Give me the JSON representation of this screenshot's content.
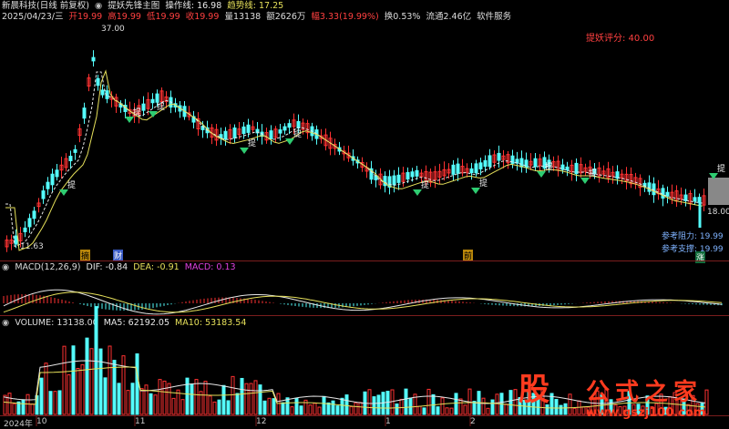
{
  "main": {
    "stock_name": "新晨科技(日线 前复权)",
    "indicator_name": "提妖先锋主图",
    "op_line": "操作线: 16.98",
    "trend_line": "趋势线: 17.25",
    "date": "2025/04/23/三",
    "open": "开19.99",
    "high": "高19.99",
    "low": "低19.99",
    "close": "收19.99",
    "volume": "量13138",
    "amount": "额2626万",
    "change": "幅3.33(19.99%)",
    "turnover": "换0.53%",
    "float": "流通2.46亿",
    "sector": "软件服务",
    "score": "提妖评分: 40.00",
    "max_price": "37.00",
    "min_price": "11.63",
    "resistance": "参考阻力: 19.99",
    "support": "参考支撑: 19.99",
    "right_price": "18.00",
    "tag_pe": "摘",
    "tag_cai": "财",
    "tag_qian": "前",
    "tag_zhang": "涨",
    "signal_text": "提"
  },
  "macd": {
    "title": "MACD(12,26,9)",
    "dif": "DIF: -0.84",
    "dea": "DEA: -0.91",
    "macd": "MACD: 0.13"
  },
  "volume": {
    "title": "VOLUME: 13138.00",
    "ma5": "MA5: 62192.05",
    "ma10": "MA10: 53183.54"
  },
  "axis": {
    "labels": [
      "2024年",
      "10",
      "11",
      "12",
      "1",
      "2"
    ]
  },
  "watermark": {
    "logo_text": "股",
    "text": "公式之家",
    "url": "www.gszj100.com"
  },
  "colors": {
    "up": "#ff3232",
    "down": "#54fcfc",
    "ma_white": "#e6e6e6",
    "ma_yellow": "#e6e05a",
    "signal": "#2ecc71"
  }
}
